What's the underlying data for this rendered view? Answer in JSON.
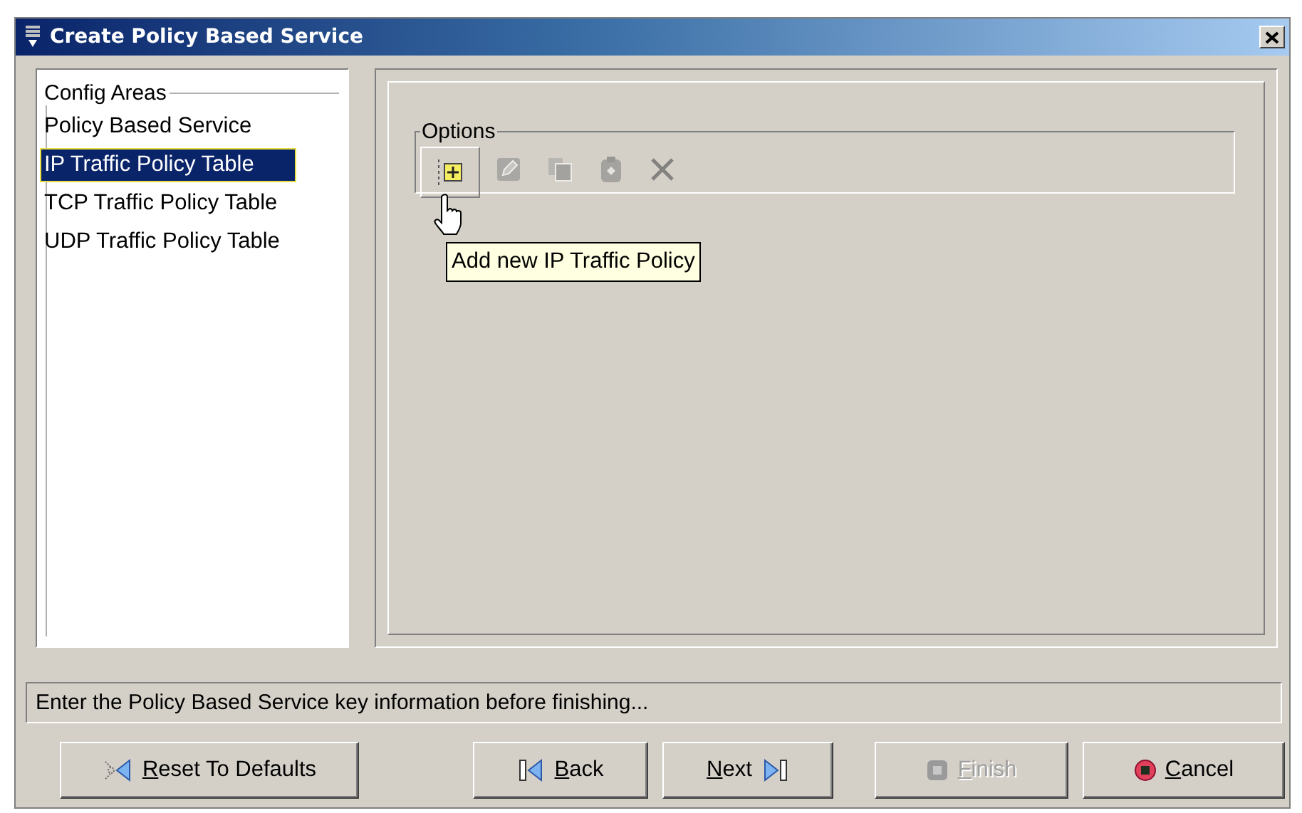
{
  "window": {
    "title": "Create Policy Based Service"
  },
  "config_areas": {
    "title": "Config Areas",
    "items": [
      {
        "label": "Policy Based Service",
        "selected": false
      },
      {
        "label": "IP Traffic Policy Table",
        "selected": true
      },
      {
        "label": "TCP Traffic Policy Table",
        "selected": false
      },
      {
        "label": "UDP Traffic Policy Table",
        "selected": false
      }
    ]
  },
  "options": {
    "title": "Options",
    "tools": [
      {
        "kind": "add",
        "disabled": false,
        "hovered": true
      },
      {
        "kind": "edit",
        "disabled": true,
        "hovered": false
      },
      {
        "kind": "copy",
        "disabled": true,
        "hovered": false
      },
      {
        "kind": "paste",
        "disabled": true,
        "hovered": false
      },
      {
        "kind": "delete",
        "disabled": true,
        "hovered": false
      }
    ],
    "tooltip": "Add new IP Traffic Policy"
  },
  "status_bar": "Enter the Policy Based Service key information before finishing...",
  "buttons": [
    {
      "label": "Reset To Defaults",
      "kind": "reset",
      "disabled": false
    },
    {
      "label": "Back",
      "kind": "back",
      "disabled": false
    },
    {
      "label": "Next",
      "kind": "next",
      "disabled": false
    },
    {
      "label": "Finish",
      "kind": "finish",
      "disabled": true
    },
    {
      "label": "Cancel",
      "kind": "cancel",
      "disabled": false
    }
  ]
}
